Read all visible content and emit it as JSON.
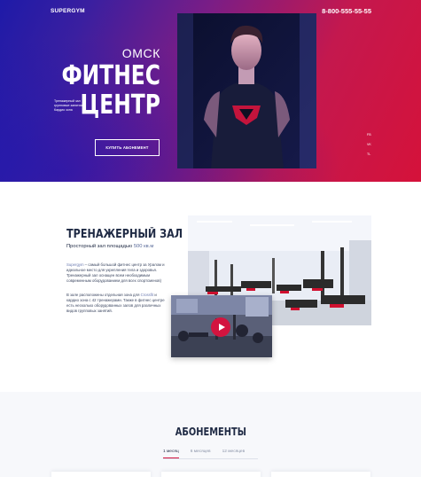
{
  "header": {
    "logo": "SUPERGYM",
    "phone": "8-800-555-55-55"
  },
  "hero": {
    "city": "ОМСК",
    "title_line1": "ФИТНЕС",
    "title_line2": "ЦЕНТР",
    "description": "Тренажерный зал групповые занятия Кардио зона",
    "buy_button": "КУПИТЬ АБОНЕМЕНТ",
    "social": [
      "FB",
      "VK",
      "TL"
    ],
    "colors": {
      "gradient_start": "#1e1aa8",
      "gradient_end": "#d5123a"
    }
  },
  "gym": {
    "title": "ТРЕНАЖЕРНЫЙ ЗАЛ",
    "subtitle_prefix": "Просторный зал площадью ",
    "subtitle_area": "500 кв.м",
    "p1_brand": "Supergym",
    "p1_text": " – самый большой фитнес центр за Уралом и идеальное место для укрепления тела и здоровья. Тренажерный зал оснащен всем необходимым современным оборудованием для всех спортсменов)",
    "p2_prefix": "В зале расположены отдельная зона для ",
    "p2_hl": "Crossfit",
    "p2_text": " и кардио зона с 42 тренажерами. Также в фитнес центре есть несколько оборудованных залов для различных видов групповых занятий.",
    "video_button_icon": "play-icon"
  },
  "subscriptions": {
    "title": "АБОНЕМЕНТЫ",
    "tabs": [
      "1 месяц",
      "6 месяцев",
      "12 месяцев"
    ],
    "active_tab": "1 месяц",
    "accent": "#d3143f"
  }
}
